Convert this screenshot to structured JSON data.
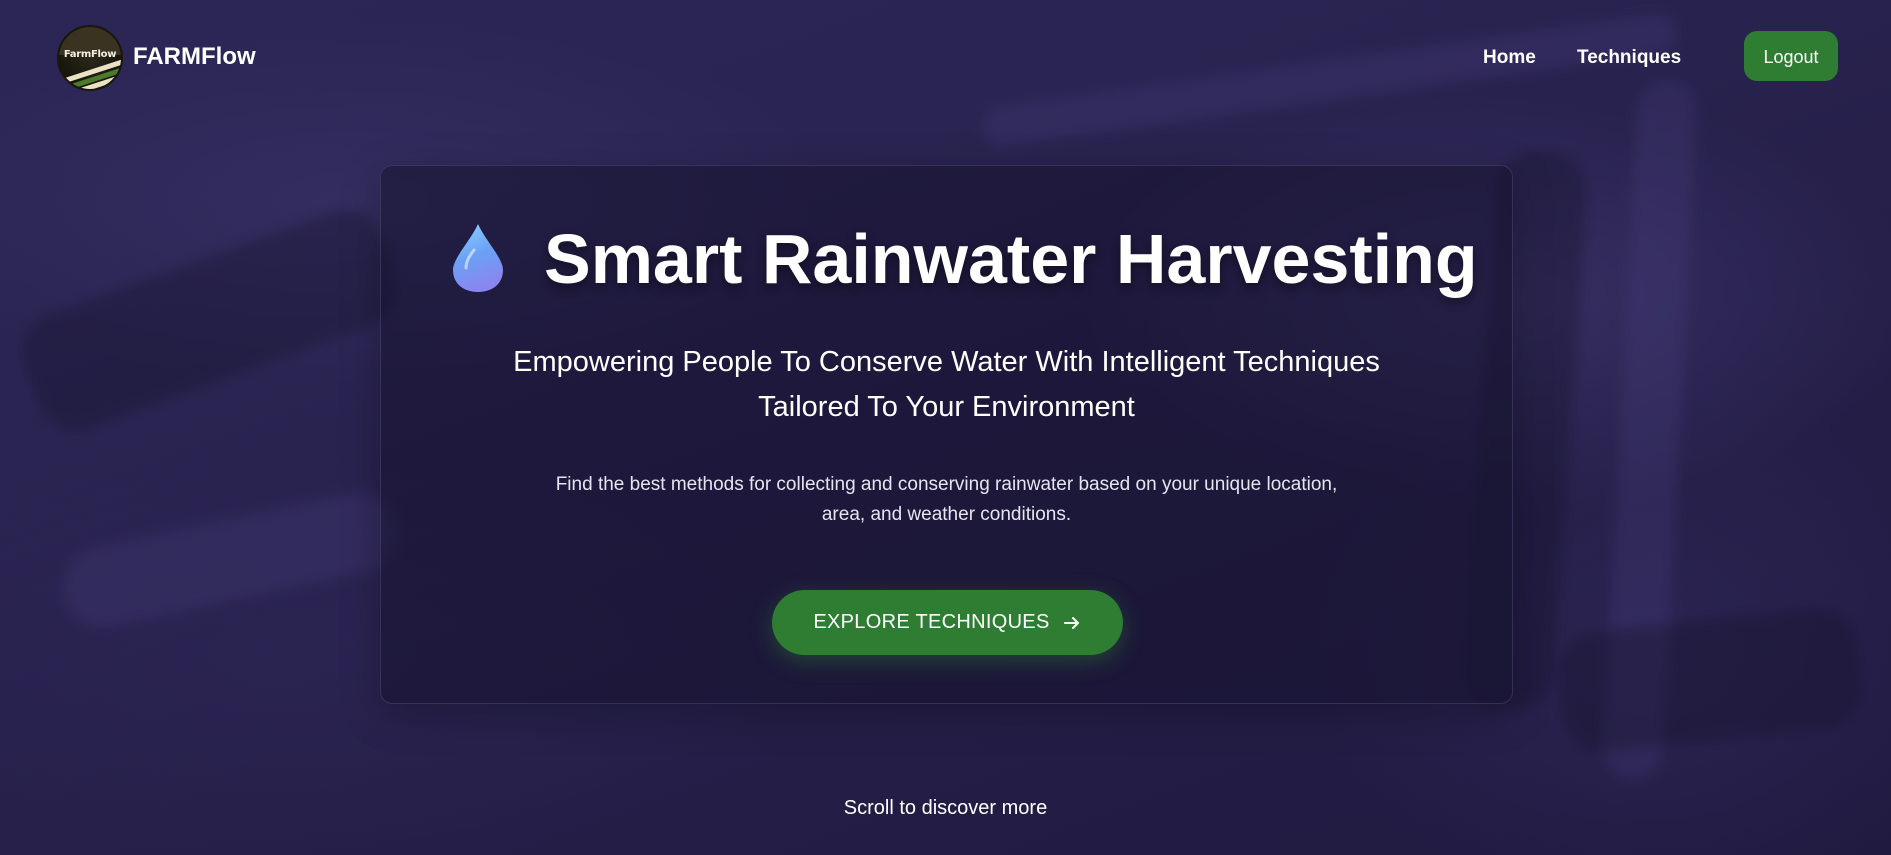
{
  "header": {
    "brand_name": "FARMFlow",
    "logo_text": "FarmFlow",
    "nav": [
      {
        "label": "Home"
      },
      {
        "label": "Techniques"
      }
    ],
    "logout_label": "Logout"
  },
  "hero": {
    "icon": "water-drop-icon",
    "title": "Smart Rainwater Harvesting",
    "subtitle": "Empowering People To Conserve Water With Intelligent Techniques Tailored To Your Environment",
    "description_lines": [
      "Find the best methods for collecting and conserving rainwater based on your unique location,",
      "area, and weather conditions."
    ],
    "cta_label": "EXPLORE TECHNIQUES",
    "cta_icon": "arrow-right-icon"
  },
  "footer": {
    "scroll_hint": "Scroll to discover more"
  },
  "colors": {
    "accent_green": "#2e7d32",
    "background": "#2a2452",
    "text": "#ffffff"
  }
}
